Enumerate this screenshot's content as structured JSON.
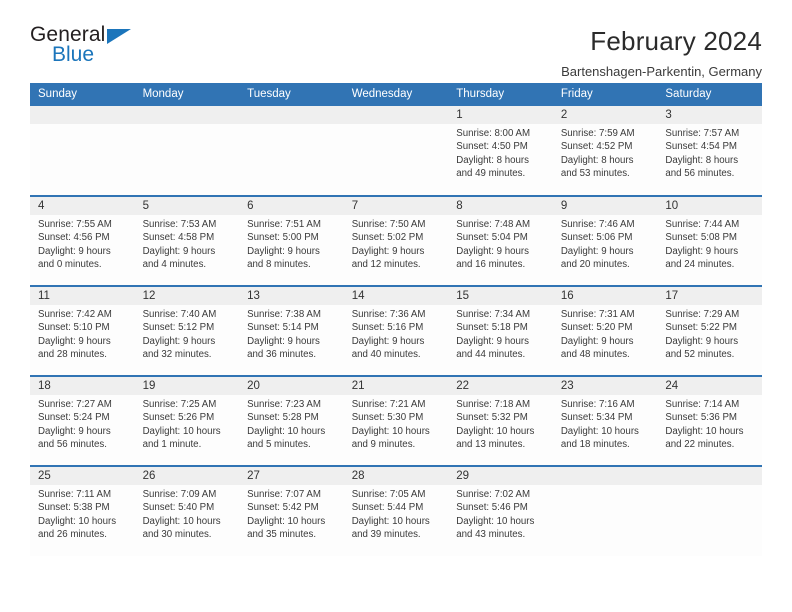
{
  "branding": {
    "name_primary": "General",
    "name_secondary": "Blue",
    "accent_color": "#1b75bb"
  },
  "header": {
    "title": "February 2024",
    "subtitle": "Bartenshagen-Parkentin, Germany"
  },
  "theme": {
    "header_blue": "#3174b4",
    "daynum_band": "#efefef",
    "cell_background": "#fdfdfd",
    "text_color": "#3a3a3a"
  },
  "weekday_headers": [
    "Sunday",
    "Monday",
    "Tuesday",
    "Wednesday",
    "Thursday",
    "Friday",
    "Saturday"
  ],
  "weeks": [
    [
      {
        "day": "",
        "empty": true
      },
      {
        "day": "",
        "empty": true
      },
      {
        "day": "",
        "empty": true
      },
      {
        "day": "",
        "empty": true
      },
      {
        "day": "1",
        "sunrise": "Sunrise: 8:00 AM",
        "sunset": "Sunset: 4:50 PM",
        "daylight_1": "Daylight: 8 hours",
        "daylight_2": "and 49 minutes."
      },
      {
        "day": "2",
        "sunrise": "Sunrise: 7:59 AM",
        "sunset": "Sunset: 4:52 PM",
        "daylight_1": "Daylight: 8 hours",
        "daylight_2": "and 53 minutes."
      },
      {
        "day": "3",
        "sunrise": "Sunrise: 7:57 AM",
        "sunset": "Sunset: 4:54 PM",
        "daylight_1": "Daylight: 8 hours",
        "daylight_2": "and 56 minutes."
      }
    ],
    [
      {
        "day": "4",
        "sunrise": "Sunrise: 7:55 AM",
        "sunset": "Sunset: 4:56 PM",
        "daylight_1": "Daylight: 9 hours",
        "daylight_2": "and 0 minutes."
      },
      {
        "day": "5",
        "sunrise": "Sunrise: 7:53 AM",
        "sunset": "Sunset: 4:58 PM",
        "daylight_1": "Daylight: 9 hours",
        "daylight_2": "and 4 minutes."
      },
      {
        "day": "6",
        "sunrise": "Sunrise: 7:51 AM",
        "sunset": "Sunset: 5:00 PM",
        "daylight_1": "Daylight: 9 hours",
        "daylight_2": "and 8 minutes."
      },
      {
        "day": "7",
        "sunrise": "Sunrise: 7:50 AM",
        "sunset": "Sunset: 5:02 PM",
        "daylight_1": "Daylight: 9 hours",
        "daylight_2": "and 12 minutes."
      },
      {
        "day": "8",
        "sunrise": "Sunrise: 7:48 AM",
        "sunset": "Sunset: 5:04 PM",
        "daylight_1": "Daylight: 9 hours",
        "daylight_2": "and 16 minutes."
      },
      {
        "day": "9",
        "sunrise": "Sunrise: 7:46 AM",
        "sunset": "Sunset: 5:06 PM",
        "daylight_1": "Daylight: 9 hours",
        "daylight_2": "and 20 minutes."
      },
      {
        "day": "10",
        "sunrise": "Sunrise: 7:44 AM",
        "sunset": "Sunset: 5:08 PM",
        "daylight_1": "Daylight: 9 hours",
        "daylight_2": "and 24 minutes."
      }
    ],
    [
      {
        "day": "11",
        "sunrise": "Sunrise: 7:42 AM",
        "sunset": "Sunset: 5:10 PM",
        "daylight_1": "Daylight: 9 hours",
        "daylight_2": "and 28 minutes."
      },
      {
        "day": "12",
        "sunrise": "Sunrise: 7:40 AM",
        "sunset": "Sunset: 5:12 PM",
        "daylight_1": "Daylight: 9 hours",
        "daylight_2": "and 32 minutes."
      },
      {
        "day": "13",
        "sunrise": "Sunrise: 7:38 AM",
        "sunset": "Sunset: 5:14 PM",
        "daylight_1": "Daylight: 9 hours",
        "daylight_2": "and 36 minutes."
      },
      {
        "day": "14",
        "sunrise": "Sunrise: 7:36 AM",
        "sunset": "Sunset: 5:16 PM",
        "daylight_1": "Daylight: 9 hours",
        "daylight_2": "and 40 minutes."
      },
      {
        "day": "15",
        "sunrise": "Sunrise: 7:34 AM",
        "sunset": "Sunset: 5:18 PM",
        "daylight_1": "Daylight: 9 hours",
        "daylight_2": "and 44 minutes."
      },
      {
        "day": "16",
        "sunrise": "Sunrise: 7:31 AM",
        "sunset": "Sunset: 5:20 PM",
        "daylight_1": "Daylight: 9 hours",
        "daylight_2": "and 48 minutes."
      },
      {
        "day": "17",
        "sunrise": "Sunrise: 7:29 AM",
        "sunset": "Sunset: 5:22 PM",
        "daylight_1": "Daylight: 9 hours",
        "daylight_2": "and 52 minutes."
      }
    ],
    [
      {
        "day": "18",
        "sunrise": "Sunrise: 7:27 AM",
        "sunset": "Sunset: 5:24 PM",
        "daylight_1": "Daylight: 9 hours",
        "daylight_2": "and 56 minutes."
      },
      {
        "day": "19",
        "sunrise": "Sunrise: 7:25 AM",
        "sunset": "Sunset: 5:26 PM",
        "daylight_1": "Daylight: 10 hours",
        "daylight_2": "and 1 minute."
      },
      {
        "day": "20",
        "sunrise": "Sunrise: 7:23 AM",
        "sunset": "Sunset: 5:28 PM",
        "daylight_1": "Daylight: 10 hours",
        "daylight_2": "and 5 minutes."
      },
      {
        "day": "21",
        "sunrise": "Sunrise: 7:21 AM",
        "sunset": "Sunset: 5:30 PM",
        "daylight_1": "Daylight: 10 hours",
        "daylight_2": "and 9 minutes."
      },
      {
        "day": "22",
        "sunrise": "Sunrise: 7:18 AM",
        "sunset": "Sunset: 5:32 PM",
        "daylight_1": "Daylight: 10 hours",
        "daylight_2": "and 13 minutes."
      },
      {
        "day": "23",
        "sunrise": "Sunrise: 7:16 AM",
        "sunset": "Sunset: 5:34 PM",
        "daylight_1": "Daylight: 10 hours",
        "daylight_2": "and 18 minutes."
      },
      {
        "day": "24",
        "sunrise": "Sunrise: 7:14 AM",
        "sunset": "Sunset: 5:36 PM",
        "daylight_1": "Daylight: 10 hours",
        "daylight_2": "and 22 minutes."
      }
    ],
    [
      {
        "day": "25",
        "sunrise": "Sunrise: 7:11 AM",
        "sunset": "Sunset: 5:38 PM",
        "daylight_1": "Daylight: 10 hours",
        "daylight_2": "and 26 minutes."
      },
      {
        "day": "26",
        "sunrise": "Sunrise: 7:09 AM",
        "sunset": "Sunset: 5:40 PM",
        "daylight_1": "Daylight: 10 hours",
        "daylight_2": "and 30 minutes."
      },
      {
        "day": "27",
        "sunrise": "Sunrise: 7:07 AM",
        "sunset": "Sunset: 5:42 PM",
        "daylight_1": "Daylight: 10 hours",
        "daylight_2": "and 35 minutes."
      },
      {
        "day": "28",
        "sunrise": "Sunrise: 7:05 AM",
        "sunset": "Sunset: 5:44 PM",
        "daylight_1": "Daylight: 10 hours",
        "daylight_2": "and 39 minutes."
      },
      {
        "day": "29",
        "sunrise": "Sunrise: 7:02 AM",
        "sunset": "Sunset: 5:46 PM",
        "daylight_1": "Daylight: 10 hours",
        "daylight_2": "and 43 minutes."
      },
      {
        "day": "",
        "empty": true
      },
      {
        "day": "",
        "empty": true
      }
    ]
  ]
}
